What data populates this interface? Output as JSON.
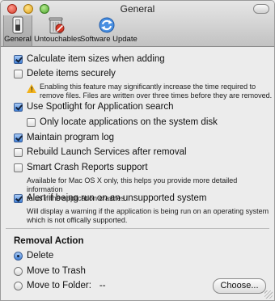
{
  "window": {
    "title": "General"
  },
  "toolbar": {
    "items": [
      {
        "label": "General",
        "icon": "switch-icon",
        "selected": true
      },
      {
        "label": "Untouchables",
        "icon": "trash-icon",
        "selected": false
      },
      {
        "label": "Software Update",
        "icon": "refresh-icon",
        "selected": false
      }
    ]
  },
  "options": {
    "calc_sizes": {
      "label": "Calculate item sizes when adding",
      "checked": true
    },
    "delete_securely": {
      "label": "Delete items securely",
      "checked": false,
      "warning_icon": "warning-icon",
      "description_line1": "Enabling this feature may significantly increase the time required to",
      "description_line2": "remove files. Files are written over three times before they are removed."
    },
    "spotlight": {
      "label": "Use Spotlight for Application search",
      "checked": true
    },
    "system_disk": {
      "label": "Only locate applications on the system disk",
      "checked": false
    },
    "program_log": {
      "label": "Maintain program log",
      "checked": true
    },
    "rebuild_ls": {
      "label": "Rebuild Launch Services after removal",
      "checked": false
    },
    "crash_reports": {
      "label": "Smart Crash Reports support",
      "checked": false,
      "description_line1": "Available for Mac OS X only, this helps you provide more detailed information",
      "description_line2": "to us if the application crashes."
    },
    "unsupported_alert": {
      "label": "Alert if being run on an unsupported system",
      "checked": true,
      "description_line1": "Will display a warning if the application is being run on an operating system",
      "description_line2": "which is not offically supported."
    }
  },
  "removal_action": {
    "title": "Removal Action",
    "delete_label": "Delete",
    "move_trash_label": "Move to Trash",
    "move_folder_label": "Move to Folder:",
    "folder_value": "--",
    "selected": "Delete",
    "choose_button": "Choose..."
  },
  "colors": {
    "accent": "#3f7fd6",
    "warning": "#f2b21a",
    "background": "#ececec"
  }
}
